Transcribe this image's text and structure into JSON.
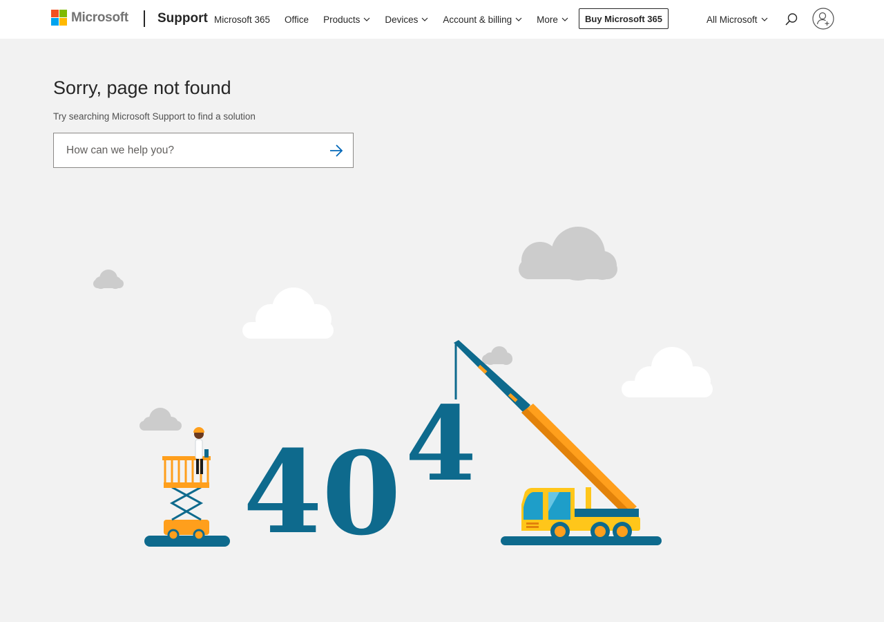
{
  "header": {
    "brand": "Microsoft",
    "section": "Support",
    "nav": [
      {
        "label": "Microsoft 365",
        "dropdown": false
      },
      {
        "label": "Office",
        "dropdown": false
      },
      {
        "label": "Products",
        "dropdown": true
      },
      {
        "label": "Devices",
        "dropdown": true
      },
      {
        "label": "Account & billing",
        "dropdown": true
      },
      {
        "label": "More",
        "dropdown": true
      }
    ],
    "buy_button": "Buy Microsoft 365",
    "all_microsoft": "All Microsoft",
    "icons": [
      "search-icon",
      "account-icon"
    ]
  },
  "main": {
    "title": "Sorry, page not found",
    "subtitle": "Try searching Microsoft Support to find a solution",
    "search": {
      "placeholder": "How can we help you?",
      "value": ""
    }
  },
  "illustration": {
    "digits": [
      "4",
      "0",
      "4"
    ]
  },
  "colors": {
    "logo_red": "#f25022",
    "logo_green": "#7fba00",
    "logo_blue": "#00a4ef",
    "logo_yellow": "#ffb900",
    "digit_blue": "#0e6a8d",
    "crane_orange": "#ff9f1c",
    "truck_yellow": "#ffc61a",
    "cloud_gray": "#cccccc",
    "background": "#f2f2f2"
  }
}
